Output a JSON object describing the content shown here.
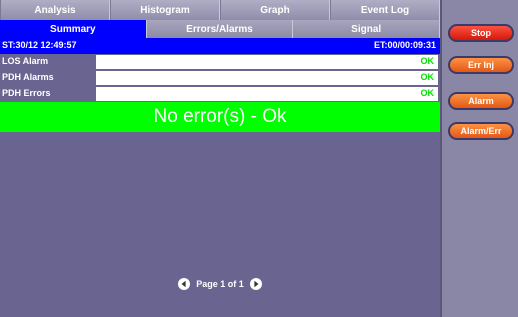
{
  "tabs": [
    "Analysis",
    "Histogram",
    "Graph",
    "Event Log"
  ],
  "subtabs": [
    "Summary",
    "Errors/Alarms",
    "Signal"
  ],
  "status": {
    "start_time": "ST:30/12 12:49:57",
    "elapsed_time": "ET:00/00:09:31"
  },
  "rows": [
    {
      "label": "LOS Alarm",
      "value": "OK"
    },
    {
      "label": "PDH Alarms",
      "value": "OK"
    },
    {
      "label": "PDH Errors",
      "value": "OK"
    }
  ],
  "banner": "No error(s) - Ok",
  "pager": {
    "text": "Page 1 of 1"
  },
  "buttons": {
    "stop": "Stop",
    "err_inj": "Err Inj",
    "alarm": "Alarm",
    "alarm_err": "Alarm/Err"
  },
  "colors": {
    "background": "#6a6590",
    "active": "#0000ff",
    "ok": "#00ff00",
    "stop": "#d01000",
    "action": "#e05010"
  }
}
